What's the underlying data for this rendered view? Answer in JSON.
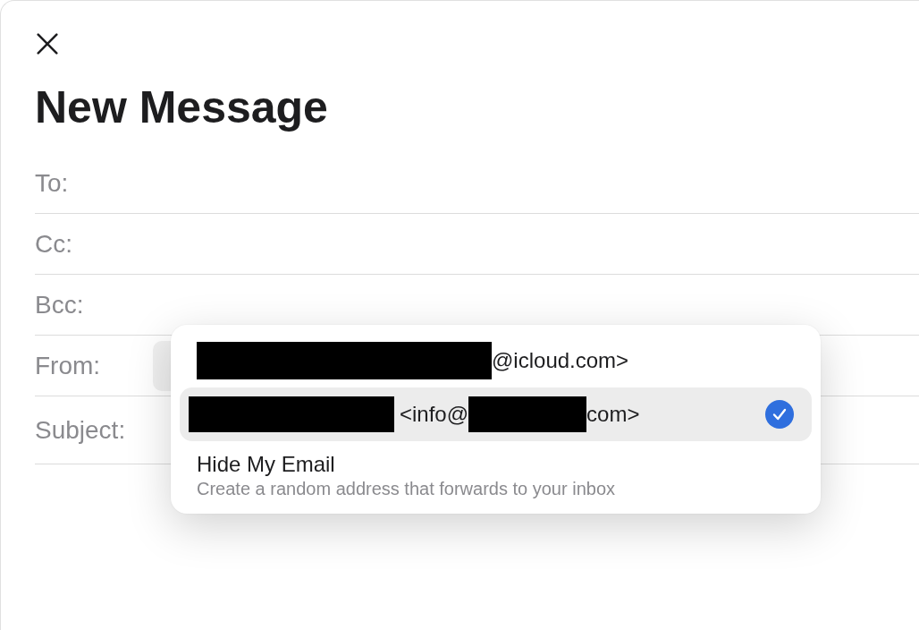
{
  "window": {
    "title": "New Message"
  },
  "fields": [
    {
      "label": "To:"
    },
    {
      "label": "Cc:"
    },
    {
      "label": "Bcc:"
    },
    {
      "label": "From:",
      "kind": "select"
    },
    {
      "label": "Subject:"
    }
  ],
  "from_menu": {
    "options": [
      {
        "kind": "address",
        "selected": false,
        "parts": [
          {
            "kind": "redacted"
          },
          {
            "kind": "text",
            "text": "@icloud.com>"
          }
        ]
      },
      {
        "kind": "address",
        "selected": true,
        "parts": [
          {
            "kind": "redacted"
          },
          {
            "kind": "text",
            "text": "<info@"
          },
          {
            "kind": "redacted"
          },
          {
            "kind": "text",
            "text": "com>"
          }
        ]
      },
      {
        "kind": "action",
        "selected": false,
        "title": "Hide My Email",
        "subtitle": "Create a random address that forwards to your inbox"
      }
    ]
  }
}
